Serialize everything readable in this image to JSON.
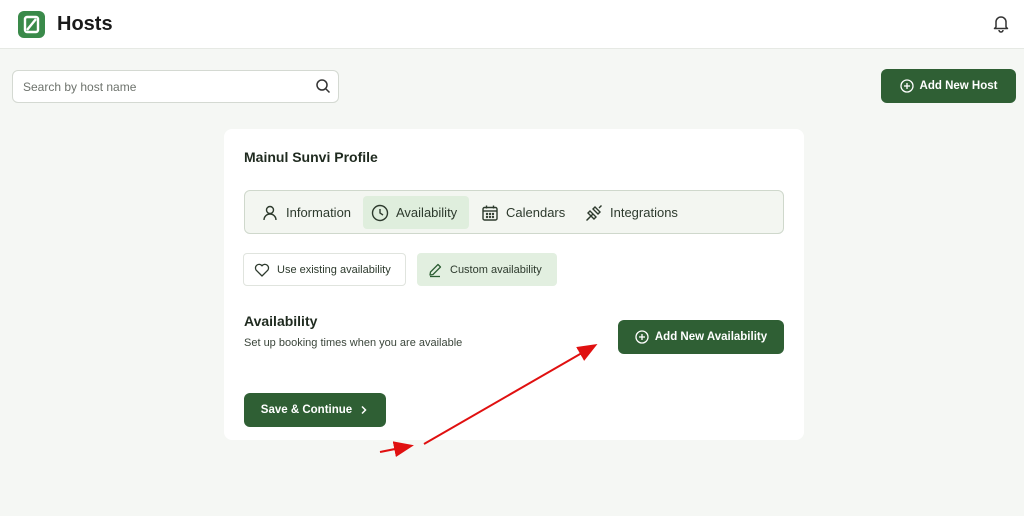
{
  "header": {
    "title": "Hosts",
    "logo_icon": "app-logo-icon",
    "bell_icon": "bell-icon"
  },
  "search": {
    "placeholder": "Search by host name",
    "value": ""
  },
  "actions": {
    "add_host_label": "Add New Host"
  },
  "profile": {
    "title": "Mainul Sunvi Profile",
    "tabs": [
      {
        "label": "Information",
        "icon": "user-icon",
        "active": false
      },
      {
        "label": "Availability",
        "icon": "clock-icon",
        "active": true
      },
      {
        "label": "Calendars",
        "icon": "calendar-icon",
        "active": false
      },
      {
        "label": "Integrations",
        "icon": "plug-icon",
        "active": false
      }
    ],
    "options": [
      {
        "label": "Use existing availability",
        "icon": "heart-icon",
        "selected": false
      },
      {
        "label": "Custom availability",
        "icon": "pencil-icon",
        "selected": true
      }
    ],
    "availability": {
      "title": "Availability",
      "subtitle": "Set up booking times when you are available",
      "add_label": "Add New Availability"
    },
    "save_label": "Save & Continue"
  },
  "colors": {
    "primary": "#2f5f34",
    "active_bg": "#dfeedd",
    "annotation": "#e01010"
  }
}
